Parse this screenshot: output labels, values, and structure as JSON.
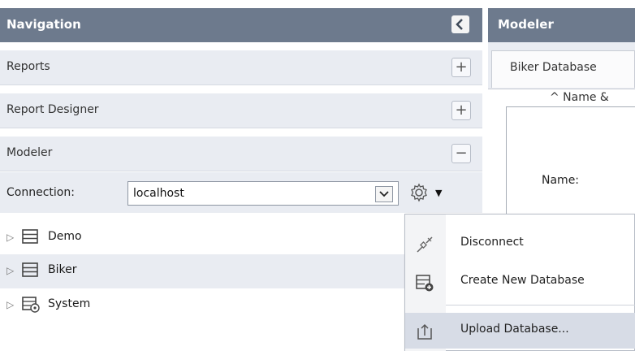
{
  "navigation": {
    "title": "Navigation",
    "collapse_icon": "chevron-left-icon",
    "sections": [
      {
        "label": "Reports",
        "toggle": "+"
      },
      {
        "label": "Report Designer",
        "toggle": "+"
      },
      {
        "label": "Modeler",
        "toggle": "−"
      }
    ],
    "connection": {
      "label": "Connection:",
      "value": "localhost",
      "dropdown_glyph": "▾",
      "settings_caret": "▼"
    },
    "tree": [
      {
        "label": "Demo",
        "icon": "database-icon"
      },
      {
        "label": "Biker",
        "icon": "database-icon"
      },
      {
        "label": "System",
        "icon": "system-database-icon"
      }
    ]
  },
  "modeler": {
    "title": "Modeler",
    "tab_label": "Biker Database",
    "section_legend": "^ Name &",
    "name_label": "Name:"
  },
  "context_menu": {
    "items": [
      {
        "label": "Disconnect",
        "icon": "disconnect-plug-icon"
      },
      {
        "label": "Create New Database",
        "icon": "create-database-icon"
      },
      {
        "label": "Upload Database...",
        "icon": "upload-icon"
      }
    ]
  },
  "colors": {
    "header_bg": "#6d7a8d",
    "section_bg": "#e9ecf2",
    "highlight": "#d7dce6"
  }
}
